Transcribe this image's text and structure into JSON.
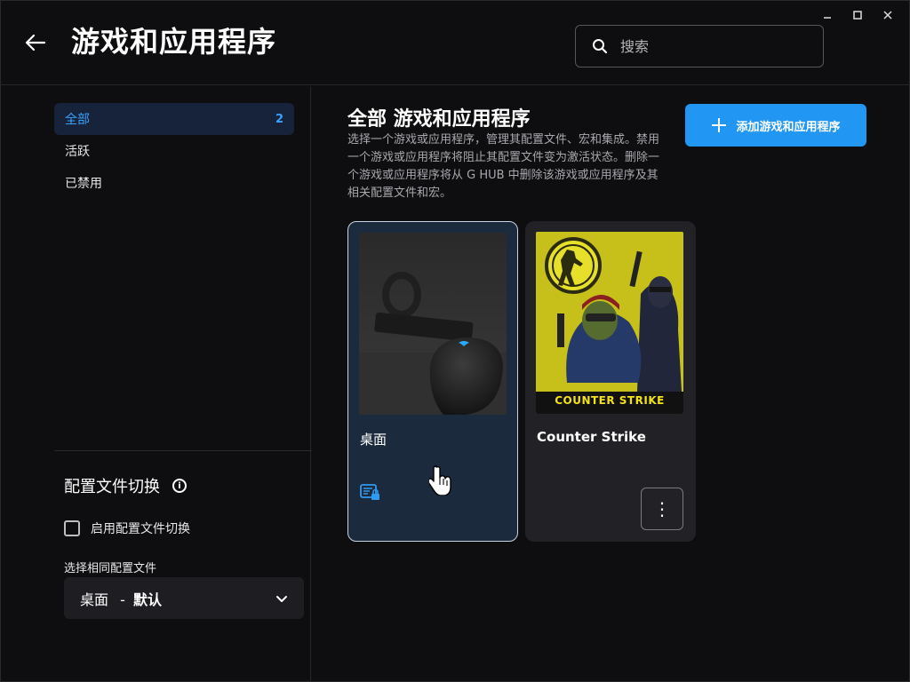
{
  "header": {
    "title": "游戏和应用程序",
    "search_placeholder": "搜索"
  },
  "window_controls": {
    "minimize": "–",
    "maximize": "□",
    "close": "✕"
  },
  "sidebar": {
    "items": [
      {
        "label": "全部",
        "count": "2",
        "active": true
      },
      {
        "label": "活跃",
        "count": ""
      },
      {
        "label": "已禁用",
        "count": ""
      }
    ],
    "profile_switch": {
      "title": "配置文件切换",
      "info": "i",
      "checkbox_label": "启用配置文件切换",
      "select_label": "选择相同配置文件",
      "select_value": "桌面",
      "select_value_suffix": "默认",
      "select_separator": "-"
    }
  },
  "main": {
    "title": "全部 游戏和应用程序",
    "description": "选择一个游戏或应用程序，管理其配置文件、宏和集成。禁用一个游戏或应用程序将阻止其配置文件变为激活状态。删除一个游戏或应用程序将从 G HUB 中删除该游戏或应用程序及其相关配置文件和宏。",
    "add_button": "添加游戏和应用程序",
    "cards": [
      {
        "name": "桌面",
        "image": "desktop-mouse-photo"
      },
      {
        "name": "Counter Strike",
        "image": "counter-strike-cover",
        "logo_text": "COUNTER STRIKE",
        "more": "⋮"
      }
    ]
  },
  "colors": {
    "accent": "#2196f3",
    "active_nav_bg": "#17233a",
    "active_text": "#3aa2ff",
    "background": "#0e0e10",
    "selected_card_bg": "#1c2a3e"
  }
}
